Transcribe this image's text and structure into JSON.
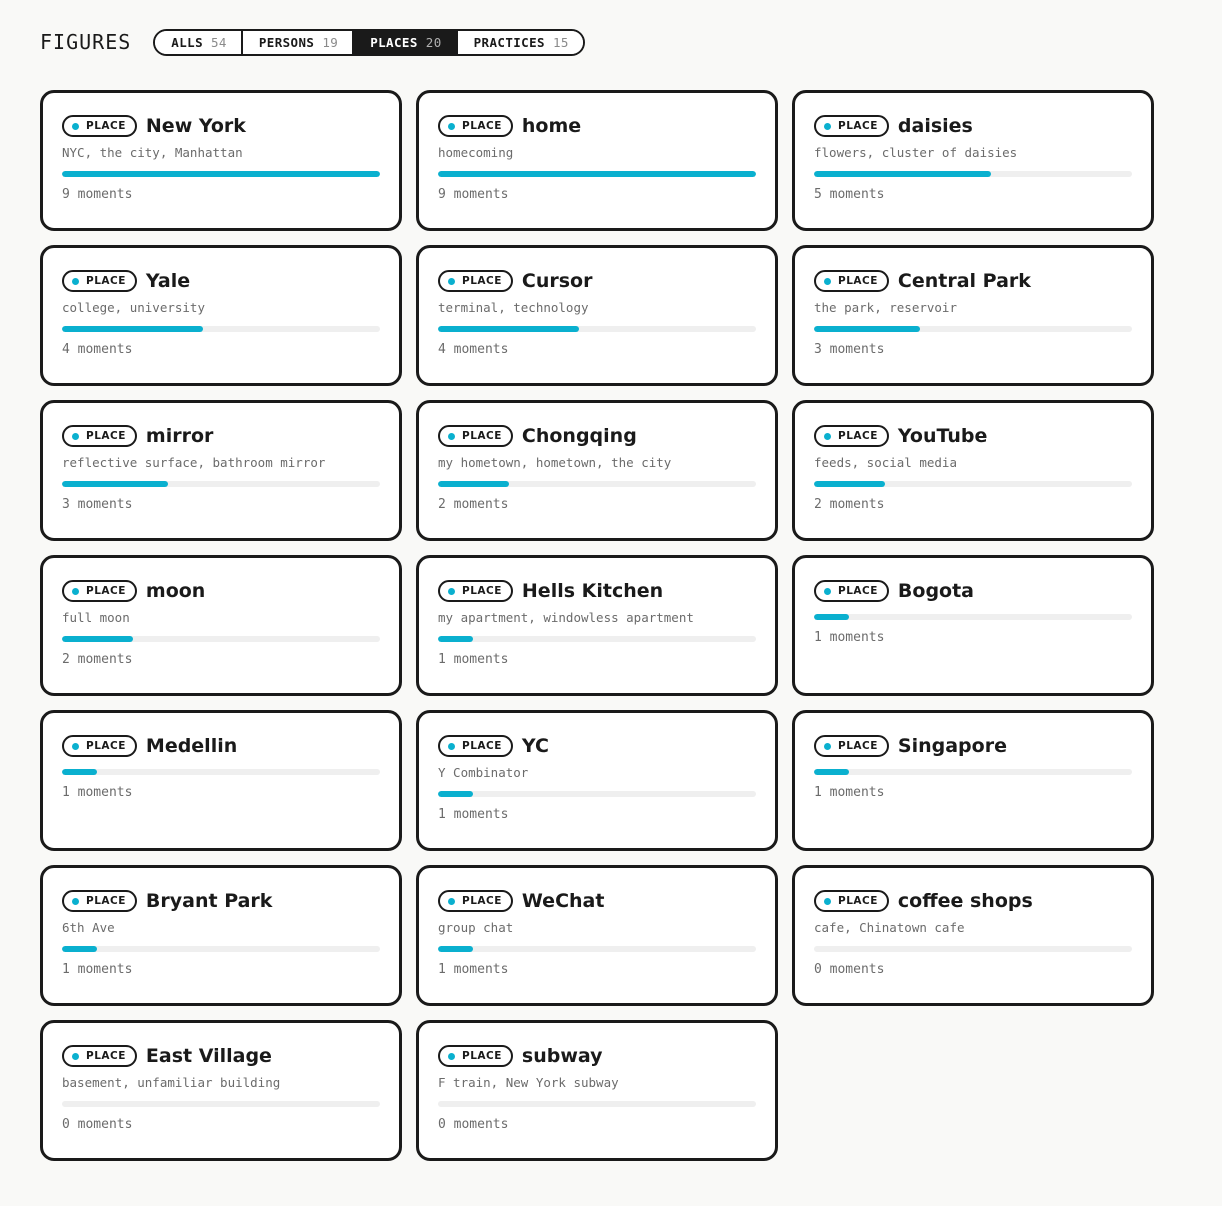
{
  "header": {
    "title": "FIGURES",
    "tabs": [
      {
        "label": "ALLS",
        "count": "54",
        "active": false
      },
      {
        "label": "PERSONS",
        "count": "19",
        "active": false
      },
      {
        "label": "PLACES",
        "count": "20",
        "active": true
      },
      {
        "label": "PRACTICES",
        "count": "15",
        "active": false
      }
    ]
  },
  "colors": {
    "accent": "#0ab0cf",
    "ink": "#1a1a1a",
    "track": "#efefef"
  },
  "max_moments": 9,
  "cards": [
    {
      "badge": "PLACE",
      "name": "New York",
      "aliases": "NYC, the city, Manhattan",
      "moments": 9,
      "moments_label": "9 moments"
    },
    {
      "badge": "PLACE",
      "name": "home",
      "aliases": "homecoming",
      "moments": 9,
      "moments_label": "9 moments"
    },
    {
      "badge": "PLACE",
      "name": "daisies",
      "aliases": "flowers, cluster of daisies",
      "moments": 5,
      "moments_label": "5 moments"
    },
    {
      "badge": "PLACE",
      "name": "Yale",
      "aliases": "college, university",
      "moments": 4,
      "moments_label": "4 moments"
    },
    {
      "badge": "PLACE",
      "name": "Cursor",
      "aliases": "terminal, technology",
      "moments": 4,
      "moments_label": "4 moments"
    },
    {
      "badge": "PLACE",
      "name": "Central Park",
      "aliases": "the park, reservoir",
      "moments": 3,
      "moments_label": "3 moments"
    },
    {
      "badge": "PLACE",
      "name": "mirror",
      "aliases": "reflective surface, bathroom mirror",
      "moments": 3,
      "moments_label": "3 moments"
    },
    {
      "badge": "PLACE",
      "name": "Chongqing",
      "aliases": "my hometown, hometown, the city",
      "moments": 2,
      "moments_label": "2 moments"
    },
    {
      "badge": "PLACE",
      "name": "YouTube",
      "aliases": "feeds, social media",
      "moments": 2,
      "moments_label": "2 moments"
    },
    {
      "badge": "PLACE",
      "name": "moon",
      "aliases": "full moon",
      "moments": 2,
      "moments_label": "2 moments"
    },
    {
      "badge": "PLACE",
      "name": "Hells Kitchen",
      "aliases": "my apartment, windowless apartment",
      "moments": 1,
      "moments_label": "1 moments"
    },
    {
      "badge": "PLACE",
      "name": "Bogota",
      "aliases": "",
      "moments": 1,
      "moments_label": "1 moments"
    },
    {
      "badge": "PLACE",
      "name": "Medellin",
      "aliases": "",
      "moments": 1,
      "moments_label": "1 moments"
    },
    {
      "badge": "PLACE",
      "name": "YC",
      "aliases": "Y Combinator",
      "moments": 1,
      "moments_label": "1 moments"
    },
    {
      "badge": "PLACE",
      "name": "Singapore",
      "aliases": "",
      "moments": 1,
      "moments_label": "1 moments"
    },
    {
      "badge": "PLACE",
      "name": "Bryant Park",
      "aliases": "6th Ave",
      "moments": 1,
      "moments_label": "1 moments"
    },
    {
      "badge": "PLACE",
      "name": "WeChat",
      "aliases": "group chat",
      "moments": 1,
      "moments_label": "1 moments"
    },
    {
      "badge": "PLACE",
      "name": "coffee shops",
      "aliases": "cafe, Chinatown cafe",
      "moments": 0,
      "moments_label": "0 moments"
    },
    {
      "badge": "PLACE",
      "name": "East Village",
      "aliases": "basement, unfamiliar building",
      "moments": 0,
      "moments_label": "0 moments"
    },
    {
      "badge": "PLACE",
      "name": "subway",
      "aliases": "F train, New York subway",
      "moments": 0,
      "moments_label": "0 moments"
    }
  ]
}
